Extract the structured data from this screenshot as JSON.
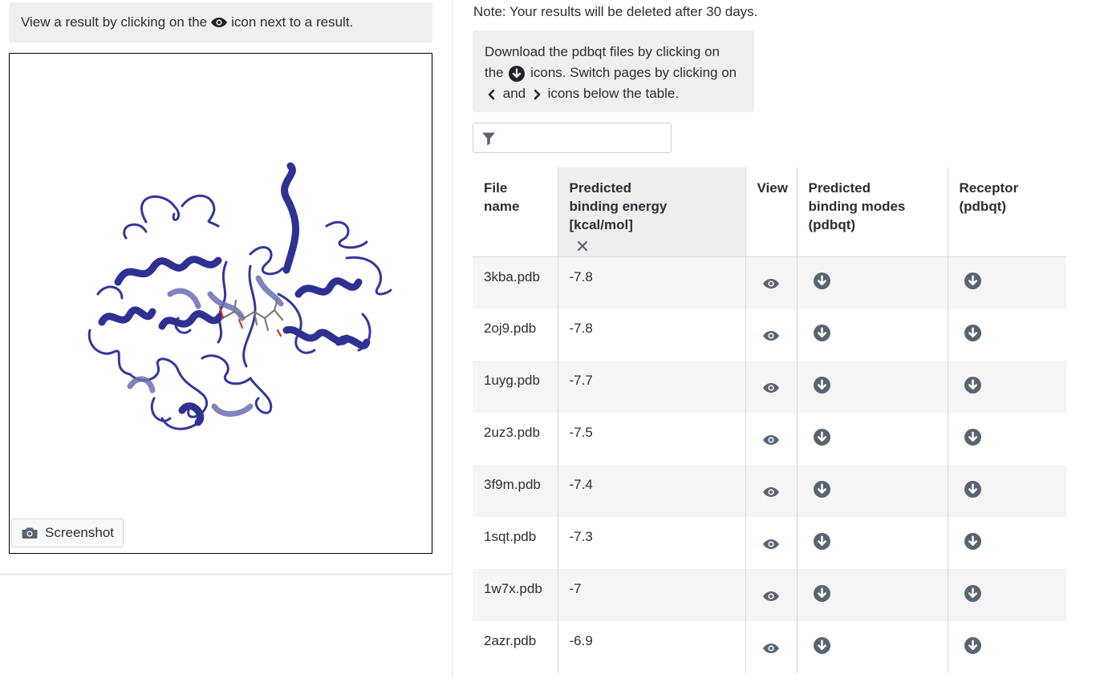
{
  "left": {
    "hint_before": "View a result by clicking on the",
    "hint_after": "icon next to a result.",
    "screenshot_label": "Screenshot"
  },
  "right": {
    "note": "Note: Your results will be deleted after 30 days.",
    "download_hint": {
      "part1": "Download the pdbqt files by clicking on the",
      "part2": "icons. Switch pages by clicking on",
      "part3": "and",
      "part4": "icons below the table."
    },
    "filter": {
      "placeholder": "",
      "value": ""
    }
  },
  "table": {
    "headers": {
      "file_name": "File name",
      "energy_line1": "Predicted",
      "energy_line2": "binding energy [kcal/mol]",
      "view": "View",
      "modes_line1": "Predicted",
      "modes_line2": "binding modes",
      "modes_line3": "(pdbqt)",
      "receptor_line1": "Receptor",
      "receptor_line2": "(pdbqt)"
    },
    "rows": [
      {
        "file": "3kba.pdb",
        "energy": "-7.8"
      },
      {
        "file": "2oj9.pdb",
        "energy": "-7.8"
      },
      {
        "file": "1uyg.pdb",
        "energy": "-7.7"
      },
      {
        "file": "2uz3.pdb",
        "energy": "-7.5"
      },
      {
        "file": "3f9m.pdb",
        "energy": "-7.4"
      },
      {
        "file": "1sqt.pdb",
        "energy": "-7.3"
      },
      {
        "file": "1w7x.pdb",
        "energy": "-7"
      },
      {
        "file": "2azr.pdb",
        "energy": "-6.9"
      }
    ]
  },
  "icons": {
    "hint_icon": "eye-icon",
    "screenshot_icon": "camera-icon",
    "download_icon": "arrow-circle-down-icon",
    "prev_icon": "chevron-left-icon",
    "next_icon": "chevron-right-icon",
    "filter_icon": "filter-icon",
    "clear_sort_icon": "close-icon",
    "view_icon": "eye-icon"
  },
  "colors": {
    "icon_gray": "#5a6470",
    "ribbon": "#2e3192",
    "ribbon_light": "#6a6fb4",
    "panel_bg": "#eeeff1",
    "row_stripe": "#f5f5f6"
  }
}
